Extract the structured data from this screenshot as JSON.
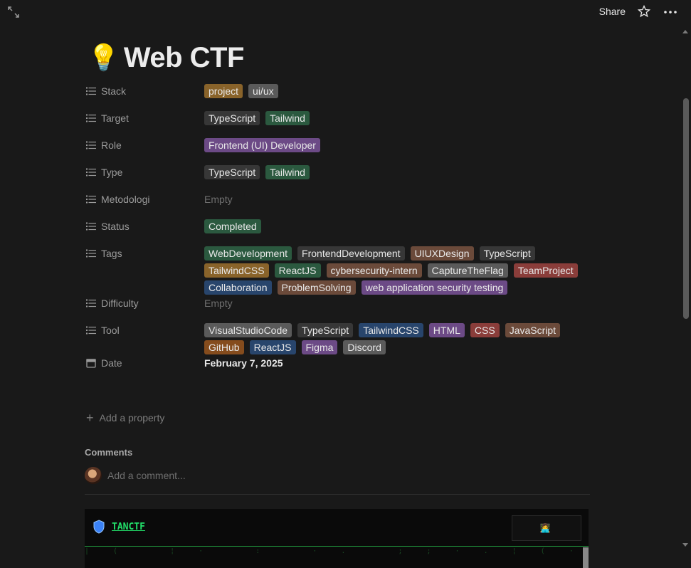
{
  "topbar": {
    "share_label": "Share"
  },
  "page": {
    "icon": "💡",
    "title": "Web CTF"
  },
  "properties": [
    {
      "label": "Stack",
      "icon": "list-icon",
      "tags": [
        {
          "text": "project",
          "color": "#89632a"
        },
        {
          "text": "ui/ux",
          "color": "#5a5a5a"
        }
      ]
    },
    {
      "label": "Target",
      "icon": "list-icon",
      "tags": [
        {
          "text": "TypeScript",
          "color": "#373737"
        },
        {
          "text": "Tailwind",
          "color": "#2b593f"
        }
      ]
    },
    {
      "label": "Role",
      "icon": "list-icon",
      "tags": [
        {
          "text": "Frontend (UI) Developer",
          "color": "#6c4a86"
        }
      ]
    },
    {
      "label": "Type",
      "icon": "list-icon",
      "tags": [
        {
          "text": "TypeScript",
          "color": "#373737"
        },
        {
          "text": "Tailwind",
          "color": "#2b593f"
        }
      ]
    },
    {
      "label": "Metodologi",
      "icon": "list-icon",
      "empty": "Empty"
    },
    {
      "label": "Status",
      "icon": "list-icon",
      "tags": [
        {
          "text": "Completed",
          "color": "#2b593f"
        }
      ]
    },
    {
      "label": "Tags",
      "icon": "list-icon",
      "tags": [
        {
          "text": "WebDevelopment",
          "color": "#2b593f"
        },
        {
          "text": "FrontendDevelopment",
          "color": "#373737"
        },
        {
          "text": "UIUXDesign",
          "color": "#6b4a3a"
        },
        {
          "text": "TypeScript",
          "color": "#373737"
        },
        {
          "text": "TailwindCSS",
          "color": "#89632a"
        },
        {
          "text": "ReactJS",
          "color": "#2b593f"
        },
        {
          "text": "cybersecurity-intern",
          "color": "#6b4a3a"
        },
        {
          "text": "CaptureTheFlag",
          "color": "#5a5a5a"
        },
        {
          "text": "TeamProject",
          "color": "#8a3d3a"
        },
        {
          "text": "Collaboration",
          "color": "#28456c"
        },
        {
          "text": "ProblemSolving",
          "color": "#6b4a3a"
        },
        {
          "text": "web application security testing",
          "color": "#6c4a86"
        }
      ]
    },
    {
      "label": "Difficulty",
      "icon": "list-icon",
      "empty": "Empty"
    },
    {
      "label": "Tool",
      "icon": "list-icon",
      "tags": [
        {
          "text": "VisualStudioCode",
          "color": "#5a5a5a"
        },
        {
          "text": "TypeScript",
          "color": "#373737"
        },
        {
          "text": "TailwindCSS",
          "color": "#28456c"
        },
        {
          "text": "HTML",
          "color": "#6c4a86"
        },
        {
          "text": "CSS",
          "color": "#8a3d3a"
        },
        {
          "text": "JavaScript",
          "color": "#6b4a3a"
        },
        {
          "text": "GitHub",
          "color": "#854c1d"
        },
        {
          "text": "ReactJS",
          "color": "#28456c"
        },
        {
          "text": "Figma",
          "color": "#6c4a86"
        },
        {
          "text": "Discord",
          "color": "#5a5a5a"
        }
      ]
    },
    {
      "label": "Date",
      "icon": "calendar-icon",
      "date": "February 7, 2025"
    }
  ],
  "add_property_label": "Add a property",
  "comments": {
    "title": "Comments",
    "placeholder": "Add a comment..."
  },
  "embed": {
    "brand": "TANCTF"
  }
}
